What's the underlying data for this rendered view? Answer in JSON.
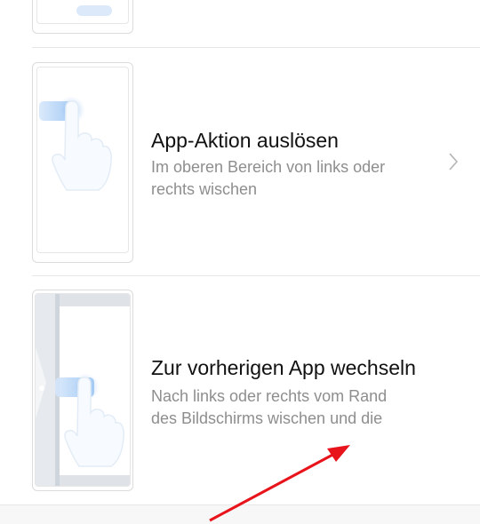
{
  "items": [
    {
      "title": "App-Aktion auslösen",
      "description": "Im oberen Bereich von links oder rechts wischen"
    },
    {
      "title": "Zur vorherigen App wechseln",
      "description_line1": "Nach links oder rechts vom Rand",
      "description_line2": "des Bildschirms wischen und die"
    }
  ],
  "colors": {
    "annotation_arrow": "#e8141b",
    "title": "#111111",
    "description": "#8e8e8e"
  },
  "icons": [
    "hand-swipe-icon",
    "chevron-right-icon"
  ]
}
